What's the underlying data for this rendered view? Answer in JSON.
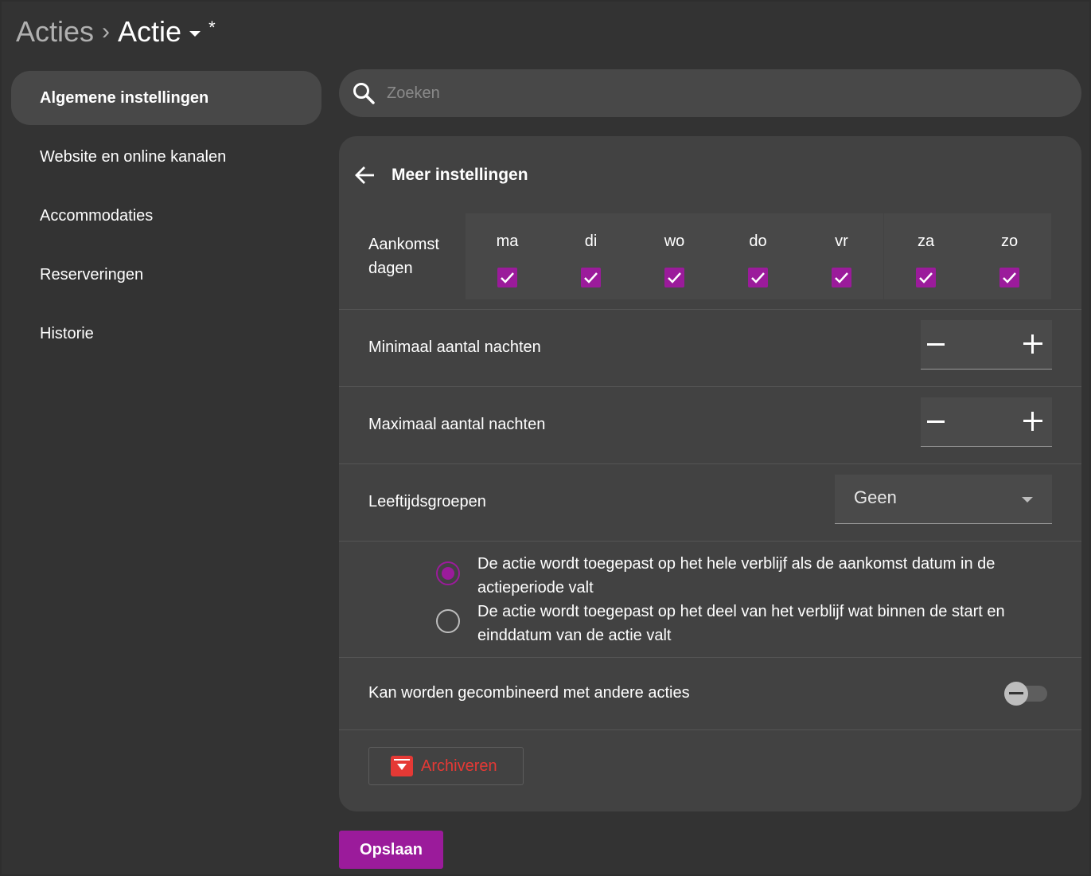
{
  "breadcrumb": {
    "parent": "Acties",
    "separator": "›",
    "current": "Actie",
    "modified": "*"
  },
  "sidebar": {
    "items": [
      {
        "label": "Algemene instellingen",
        "active": true
      },
      {
        "label": "Website en online kanalen"
      },
      {
        "label": "Accommodaties"
      },
      {
        "label": "Reserveringen"
      },
      {
        "label": "Historie"
      }
    ]
  },
  "search": {
    "placeholder": "Zoeken"
  },
  "panel": {
    "title": "Meer instellingen",
    "arrival_days": {
      "label_line1": "Aankomst",
      "label_line2": "dagen",
      "days": [
        {
          "label": "ma",
          "checked": true
        },
        {
          "label": "di",
          "checked": true
        },
        {
          "label": "wo",
          "checked": true
        },
        {
          "label": "do",
          "checked": true
        },
        {
          "label": "vr",
          "checked": true
        },
        {
          "label": "za",
          "checked": true
        },
        {
          "label": "zo",
          "checked": true
        }
      ]
    },
    "min_nights": {
      "label": "Minimaal aantal nachten"
    },
    "max_nights": {
      "label": "Maximaal aantal nachten"
    },
    "age_groups": {
      "label": "Leeftijdsgroepen",
      "value": "Geen"
    },
    "apply_options": [
      {
        "label": "De actie wordt toegepast op het hele verblijf als de aankomst datum in de actieperiode valt",
        "checked": true
      },
      {
        "label": "De actie wordt toegepast op het deel van het verblijf wat binnen de start en einddatum van de actie valt",
        "checked": false
      }
    ],
    "combine": {
      "label": "Kan worden gecombineerd met andere acties",
      "enabled": false
    },
    "archive_label": "Archiveren"
  },
  "save_label": "Opslaan",
  "colors": {
    "accent": "#9b1b9b",
    "danger": "#e53935",
    "background": "#333333",
    "panel": "#424242"
  }
}
